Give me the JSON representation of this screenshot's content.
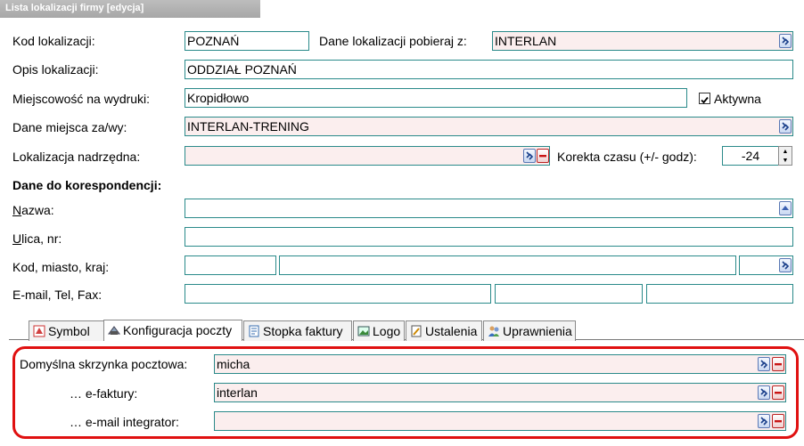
{
  "window": {
    "title": "Lista lokalizacji firmy [edycja]"
  },
  "form": {
    "kod_label": "Kod lokalizacji:",
    "kod_value": "POZNAŃ",
    "dane_pobieraj_label": "Dane lokalizacji pobieraj z:",
    "dane_pobieraj_value": "INTERLAN",
    "opis_label": "Opis lokalizacji:",
    "opis_value": "ODDZIAŁ POZNAŃ",
    "miejscowosc_label": "Miejscowość na wydruki:",
    "miejscowosc_value": "Kropidłowo",
    "aktywna_label": "Aktywna",
    "aktywna_checked": true,
    "dane_miejsca_label": "Dane miejsca za/wy:",
    "dane_miejsca_value": "INTERLAN-TRENING",
    "nadrzedna_label": "Lokalizacja nadrzędna:",
    "nadrzedna_value": "",
    "korekta_label": "Korekta czasu (+/- godz):",
    "korekta_value": "-24"
  },
  "korespondencja": {
    "title": "Dane do korespondencji:",
    "nazwa_label_first": "N",
    "nazwa_label_rest": "azwa:",
    "nazwa_value": "",
    "ulica_label_first": "U",
    "ulica_label_rest": "lica, nr:",
    "ulica_value": "",
    "kod_label": "Kod, miasto, kraj:",
    "kod_value": "",
    "miasto_value": "",
    "kraj_value": "",
    "email_label": "E-mail, Tel, Fax:",
    "email_value": "",
    "tel_value": "",
    "fax_value": ""
  },
  "tabs": [
    {
      "label": "Symbol",
      "icon": "symbol-icon"
    },
    {
      "label": "Konfiguracja poczty",
      "icon": "mail-config-icon",
      "active": true
    },
    {
      "label": "Stopka faktury",
      "icon": "document-icon"
    },
    {
      "label": "Logo",
      "icon": "image-icon"
    },
    {
      "label": "Ustalenia",
      "icon": "settings-doc-icon"
    },
    {
      "label": "Uprawnienia",
      "icon": "users-icon"
    }
  ],
  "poczta": {
    "domyslna_label": "Domyślna skrzynka pocztowa:",
    "domyslna_value": "micha",
    "efaktury_label": "… e-faktury:",
    "efaktury_value": "interlan",
    "integrator_label": "… e-mail integrator:",
    "integrator_value": ""
  },
  "colors": {
    "field_border": "#2a8a8a",
    "field_pink": "#fbeeee",
    "highlight_red": "#e01010"
  }
}
